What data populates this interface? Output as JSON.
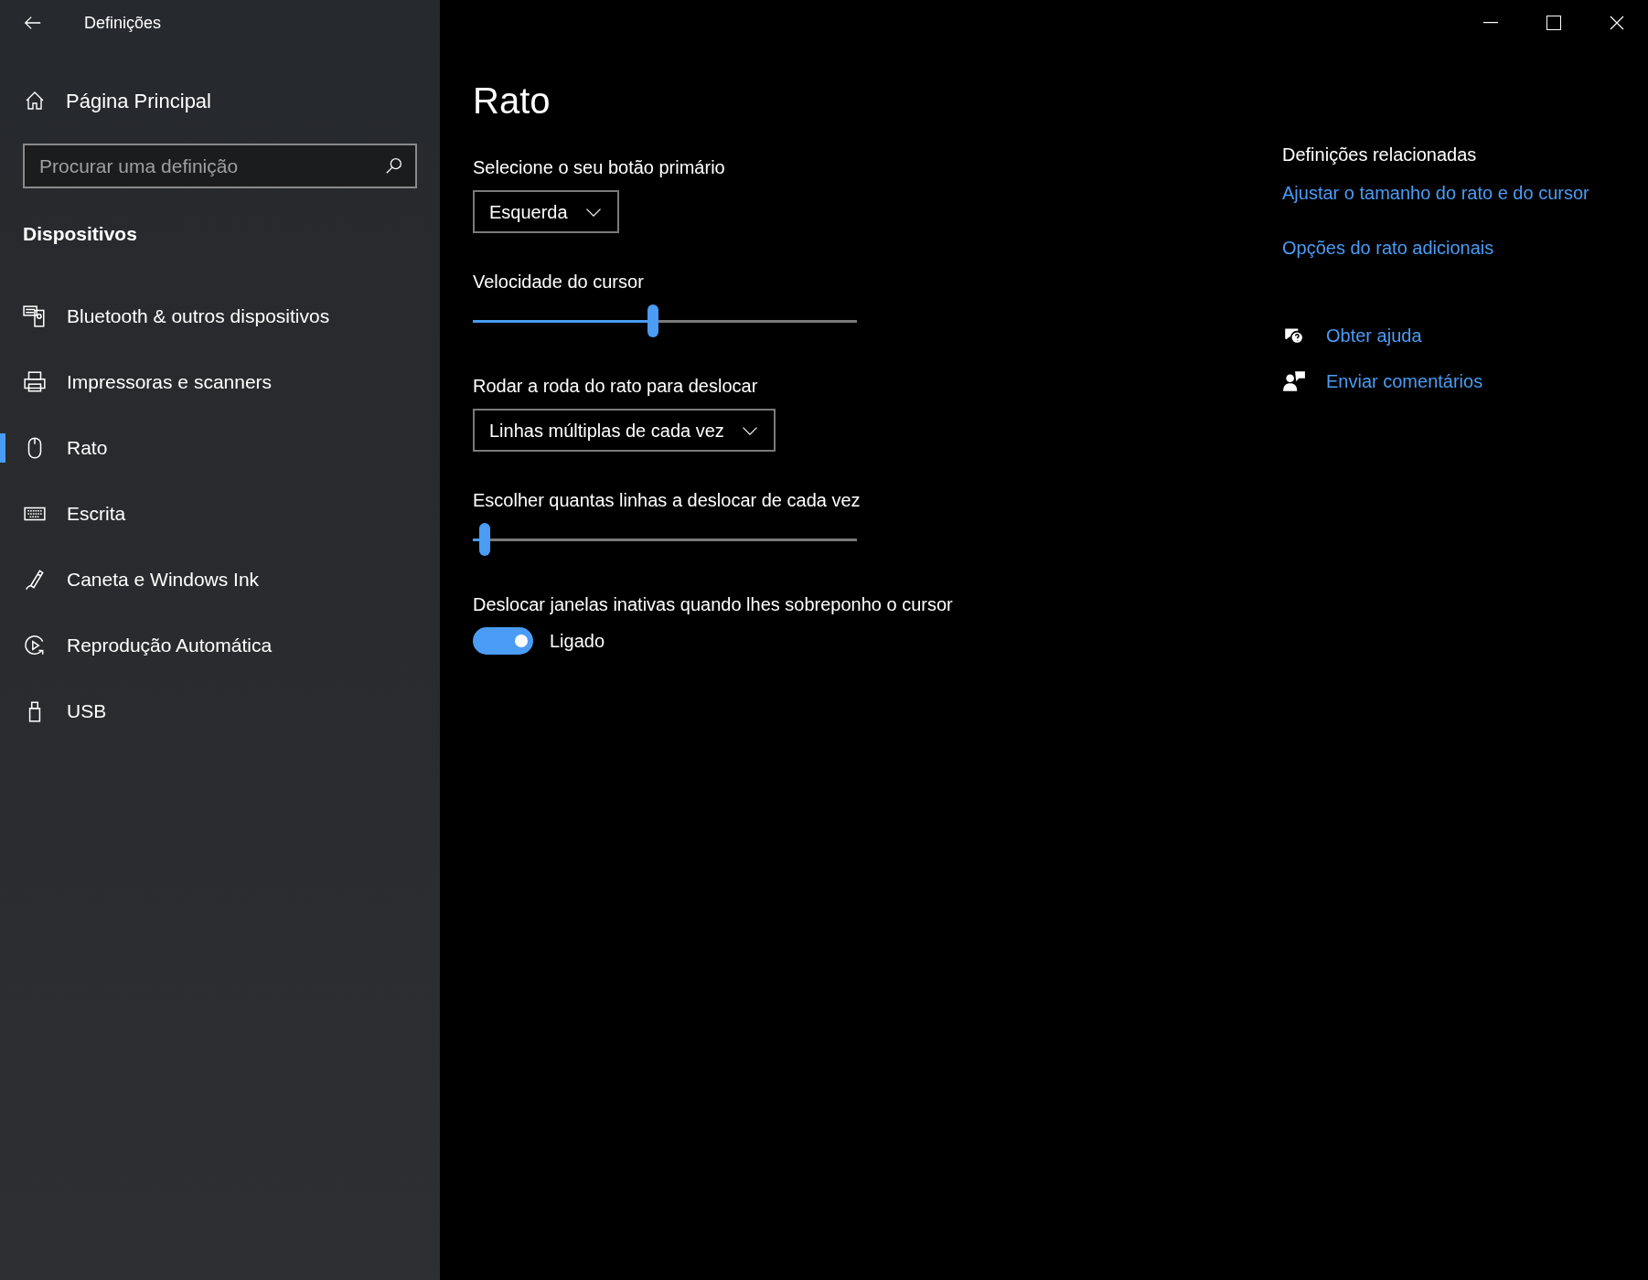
{
  "window": {
    "title": "Definições"
  },
  "sidebar": {
    "home": "Página Principal",
    "search": {
      "placeholder": "Procurar uma definição"
    },
    "section": "Dispositivos",
    "items": [
      {
        "label": "Bluetooth & outros dispositivos",
        "kind": "bluetooth",
        "selected": false
      },
      {
        "label": "Impressoras e scanners",
        "kind": "printer",
        "selected": false
      },
      {
        "label": "Rato",
        "kind": "mouse",
        "selected": true
      },
      {
        "label": "Escrita",
        "kind": "keyboard",
        "selected": false
      },
      {
        "label": "Caneta e Windows Ink",
        "kind": "pen",
        "selected": false
      },
      {
        "label": "Reprodução Automática",
        "kind": "autoplay",
        "selected": false
      },
      {
        "label": "USB",
        "kind": "usb",
        "selected": false
      }
    ]
  },
  "page": {
    "title": "Rato",
    "settings": [
      {
        "kind": "dropdown",
        "label": "Selecione o seu botão primário",
        "value": "Esquerda"
      },
      {
        "kind": "slider",
        "label": "Velocidade do cursor",
        "level": 0.47
      },
      {
        "kind": "dropdown",
        "label": "Rodar a roda do rato para deslocar",
        "value": "Linhas múltiplas de cada vez"
      },
      {
        "kind": "slider",
        "label": "Escolher quantas linhas a deslocar de cada vez",
        "level": 0.03
      },
      {
        "kind": "toggle",
        "label": "Deslocar janelas inativas quando lhes sobreponho o cursor",
        "on": true,
        "state_text": "Ligado"
      }
    ]
  },
  "related": {
    "heading": "Definições relacionadas",
    "links": [
      "Ajustar o tamanho do rato e do cursor",
      "Opções do rato adicionais"
    ],
    "help": [
      {
        "kind": "help",
        "label": "Obter ajuda"
      },
      {
        "kind": "feedback",
        "label": "Enviar comentários"
      }
    ]
  }
}
